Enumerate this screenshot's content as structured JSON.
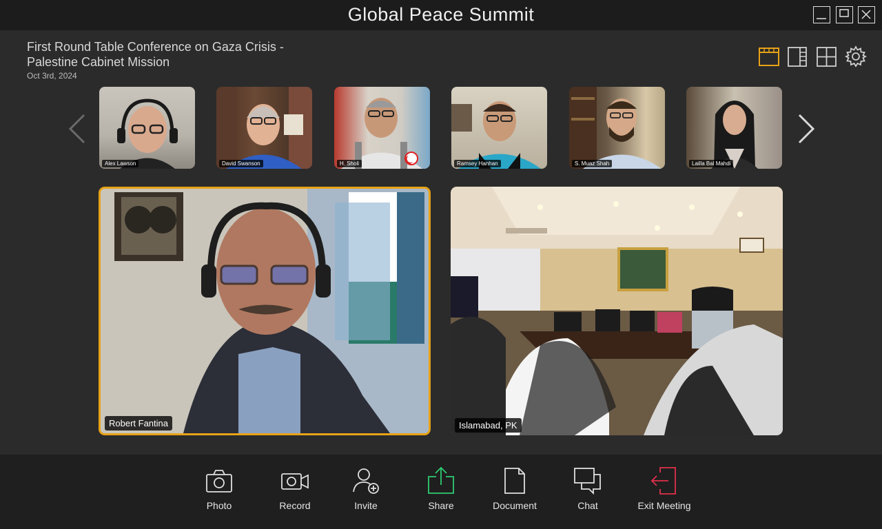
{
  "window": {
    "title": "Global Peace Summit"
  },
  "meeting": {
    "title": "First Round Table Conference on Gaza Crisis - Palestine Cabinet Mission",
    "date": "Oct 3rd, 2024"
  },
  "layout_options": [
    "grid-layout-icon",
    "sidebar-layout-icon",
    "quad-layout-icon",
    "settings-icon"
  ],
  "participants": [
    {
      "name": "Alex Lawson"
    },
    {
      "name": "David Swanson"
    },
    {
      "name": "H. Sholi"
    },
    {
      "name": "Ramsey Hanhan"
    },
    {
      "name": "S. Muaz Shah"
    },
    {
      "name": "Lailla Bal Mahdi"
    }
  ],
  "main_tiles": [
    {
      "name": "Robert Fantina",
      "active": true
    },
    {
      "name": "Islamabad, PK",
      "active": false
    }
  ],
  "toolbar": {
    "photo": "Photo",
    "record": "Record",
    "invite": "Invite",
    "share": "Share",
    "document": "Document",
    "chat": "Chat",
    "exit": "Exit Meeting"
  },
  "colors": {
    "accent": "#e8a317",
    "share": "#2ecc71",
    "exit": "#e0304a",
    "background": "#2b2b2b",
    "titlebar": "#1c1c1c"
  }
}
